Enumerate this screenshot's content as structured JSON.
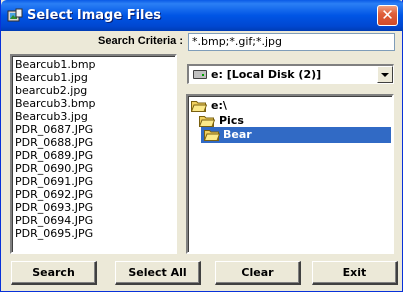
{
  "window": {
    "title": "Select Image Files",
    "icon": "image-files-app-icon",
    "close_glyph": "✕"
  },
  "criteria": {
    "label": "Search Criteria :",
    "value": "*.bmp;*.gif;*.jpg"
  },
  "files": [
    "Bearcub1.bmp",
    "Bearcub1.jpg",
    "bearcub2.jpg",
    "Bearcub3.bmp",
    "Bearcub3.jpg",
    "PDR_0687.JPG",
    "PDR_0688.JPG",
    "PDR_0689.JPG",
    "PDR_0690.JPG",
    "PDR_0691.JPG",
    "PDR_0692.JPG",
    "PDR_0693.JPG",
    "PDR_0694.JPG",
    "PDR_0695.JPG"
  ],
  "drive": {
    "value": "e: [Local Disk (2)]",
    "icon": "hard-drive-icon"
  },
  "directories": [
    {
      "label": "e:\\",
      "icon": "open-folder-icon",
      "selected": false
    },
    {
      "label": "Pics",
      "icon": "open-folder-icon",
      "selected": false
    },
    {
      "label": "Bear",
      "icon": "open-folder-icon",
      "selected": true
    }
  ],
  "buttons": {
    "search": "Search",
    "select_all": "Select All",
    "clear": "Clear",
    "exit": "Exit"
  },
  "colors": {
    "titlebar": "#0055e5",
    "selection": "#316ac5",
    "close": "#d04a28",
    "face": "#ece9d8"
  }
}
